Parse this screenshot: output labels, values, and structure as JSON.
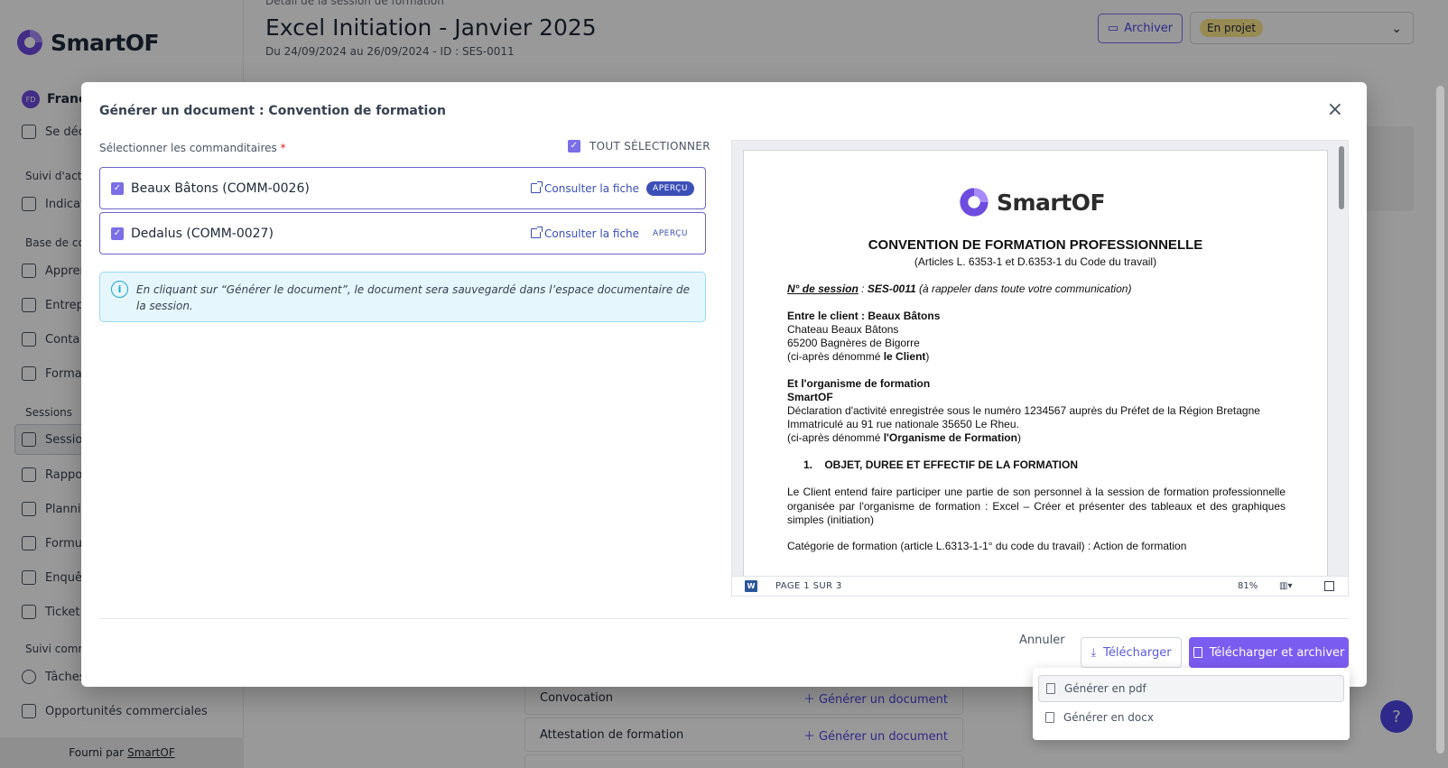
{
  "app": {
    "brand": "SmartOF",
    "user": {
      "initials": "FD",
      "name": "Franc"
    },
    "logout": "Se déc",
    "sections": {
      "suivi_activite": "Suivi d'acti",
      "base": "Base de co",
      "sessions": "Sessions",
      "suivi_commercial": "Suivi comm"
    },
    "nav": {
      "indicateurs": "Indicat",
      "apprenants": "Appren",
      "entreprises": "Entrep",
      "contacts": "Conta",
      "formations": "Forma",
      "sessions": "Sessio",
      "rapports": "Rappo",
      "planning": "Planni",
      "formulaires": "Formu",
      "enquetes": "Enquê",
      "tickets": "Ticket",
      "taches": "Tâches",
      "opportunites": "Opportunités commerciales"
    },
    "footer": {
      "prefix": "Fourni par",
      "link": "SmartOF"
    },
    "page": {
      "breadcrumb": "Détail de la session de formation",
      "title": "Excel Initiation - Janvier 2025",
      "subtitle": "Du 24/09/2024 au 26/09/2024 - ID : SES-0011",
      "archive_button": "Archiver",
      "status": "En projet"
    },
    "doc_rows": [
      {
        "label": "Convocation",
        "action": "Générer un document"
      },
      {
        "label": "Attestation de formation",
        "action": "Générer un document"
      }
    ],
    "help": "?"
  },
  "modal": {
    "title": "Générer un document : Convention de formation",
    "select_label": "Sélectionner les commanditaires",
    "required_mark": "*",
    "select_all": "TOUT SÉLECTIONNER",
    "clients": [
      {
        "name": "Beaux Bâtons (COMM-0026)",
        "consult": "Consulter la fiche",
        "preview": "APERÇU",
        "checked": true
      },
      {
        "name": "Dedalus (COMM-0027)",
        "consult": "Consulter la fiche",
        "preview": "APERÇU",
        "checked": true
      }
    ],
    "info": "En cliquant sur “Générer le document”, le document sera sauvegardé dans l’espace documentaire de la session.",
    "preview_doc": {
      "logo": "SmartOF",
      "title": "CONVENTION DE FORMATION PROFESSIONNELLE",
      "subtitle": "(Articles L. 6353-1 et D.6353-1 du Code du travail)",
      "session_label": "N° de session",
      "session_sep": " : ",
      "session_id": "SES-0011",
      "session_note": " (à rappeler dans toute votre communication)",
      "client_head": "Entre le client : Beaux Bâtons",
      "client_line1": "Chateau Beaux Bâtons",
      "client_line2": "65200 Bagnères de Bigorre",
      "client_line3_pre": "(ci-après dénommé ",
      "client_line3_bold": "le Client",
      "client_line3_post": ")",
      "org_head": "Et l'organisme de formation",
      "org_name": "SmartOF",
      "org_line1": "Déclaration d'activité enregistrée sous le numéro 1234567 auprès du Préfet de la Région Bretagne",
      "org_line2": "Immatriculé au 91 rue nationale 35650 Le Rheu.",
      "org_line3_pre": "(ci-après dénommé ",
      "org_line3_bold": "l'Organisme de Formation",
      "org_line3_post": ")",
      "section1": "1.    OBJET, DUREE ET EFFECTIF DE LA FORMATION",
      "para1": "Le Client entend faire participer une partie de son personnel à la session de formation professionnelle organisée par l'organisme de formation : Excel – Créer et présenter des tableaux et des graphiques simples (initiation)",
      "para2": "Catégorie de formation (article L.6313-1-1° du code du travail) : Action de formation"
    },
    "preview_bar": {
      "page": "PAGE 1 SUR 3",
      "zoom": "81%",
      "word_icon": "W"
    },
    "buttons": {
      "cancel": "Annuler",
      "download": "Télécharger",
      "download_archive": "Télécharger et archiver"
    },
    "dropdown": [
      {
        "label": "Générer en pdf"
      },
      {
        "label": "Générer en docx"
      }
    ],
    "close": "×"
  },
  "colors": {
    "primary": "#7b5cf0",
    "link": "#3b4fb8",
    "info_bg": "#e6f6fd",
    "status_pill": "#fde68a"
  }
}
